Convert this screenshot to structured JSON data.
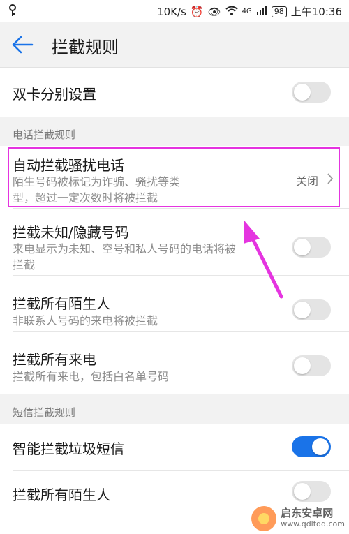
{
  "status_bar": {
    "speed": "10K/s",
    "network": "4G",
    "battery": "98",
    "time": "上午10:36"
  },
  "header": {
    "title": "拦截规则"
  },
  "dual_sim": {
    "label": "双卡分别设置",
    "enabled": false
  },
  "call_section": {
    "title": "电话拦截规则",
    "items": [
      {
        "title": "自动拦截骚扰电话",
        "subtitle_line1": "陌生号码被标记为诈骗、骚扰等类",
        "subtitle_line2": "型，超过一定次数时将被拦截",
        "value": "关闭"
      },
      {
        "title": "拦截未知/隐藏号码",
        "subtitle_line1": "来电显示为未知、空号和私人号码的电话将被",
        "subtitle_line2": "拦截",
        "enabled": false
      },
      {
        "title": "拦截所有陌生人",
        "subtitle": "非联系人号码的来电将被拦截",
        "enabled": false
      },
      {
        "title": "拦截所有来电",
        "subtitle": "拦截所有来电，包括白名单号码",
        "enabled": false
      }
    ]
  },
  "sms_section": {
    "title": "短信拦截规则",
    "items": [
      {
        "title": "智能拦截垃圾短信",
        "enabled": true
      },
      {
        "title": "拦截所有陌生人",
        "enabled": false
      }
    ]
  },
  "watermark": {
    "name": "启东安卓网",
    "url": "www.qdltdq.com"
  },
  "colors": {
    "accent": "#1a73e8",
    "annotation": "#e534e0"
  }
}
